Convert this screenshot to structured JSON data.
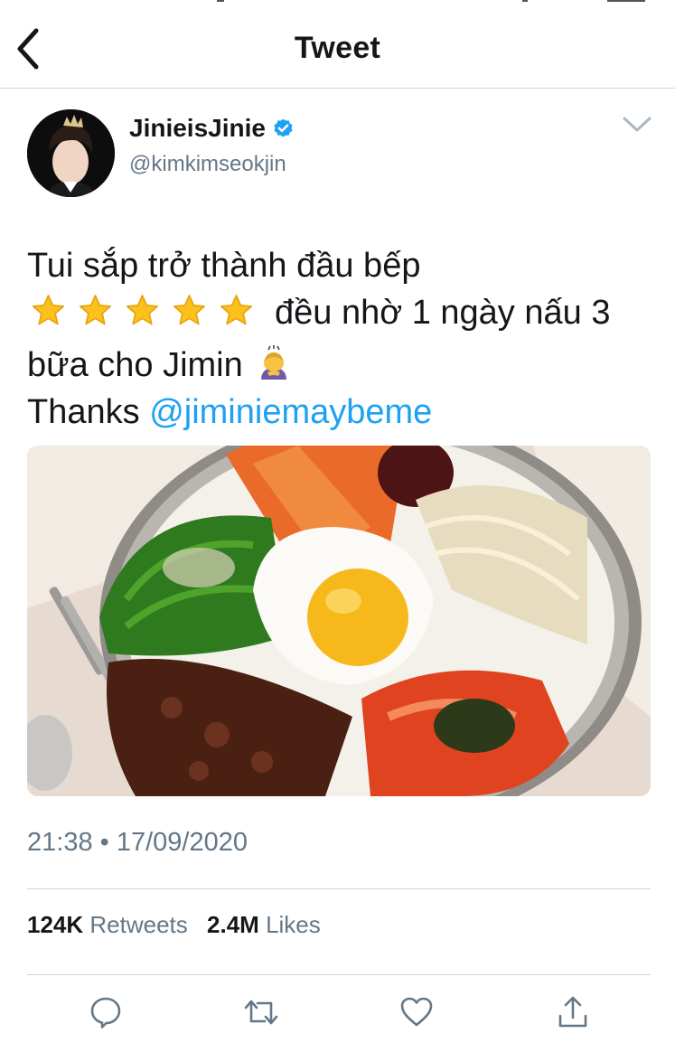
{
  "header": {
    "title": "Tweet"
  },
  "tweet": {
    "author_name": "JinieisJinie",
    "author_handle": "@kimkimseokjin",
    "text_line1": "Tui sắp trở thành đầu bếp",
    "star_count": 5,
    "text_line2_after_stars": "đều nhờ 1 ngày nấu 3",
    "text_line3": "bữa cho Jimin",
    "text_line4_prefix": "Thanks",
    "mention": "@jiminiemaybeme",
    "timestamp": "21:38 • 17/09/2020",
    "retweets_count": "124K",
    "retweets_label": "Retweets",
    "likes_count": "2.4M",
    "likes_label": "Likes"
  },
  "icons": {
    "back": "chevron-left-icon",
    "verified": "verified-badge-icon",
    "more": "chevron-down-icon",
    "reply": "reply-icon",
    "retweet": "retweet-icon",
    "like": "heart-icon",
    "share": "share-icon"
  },
  "colors": {
    "link": "#1da1f2",
    "secondary_text": "#657786",
    "divider": "#cfd4d9"
  }
}
